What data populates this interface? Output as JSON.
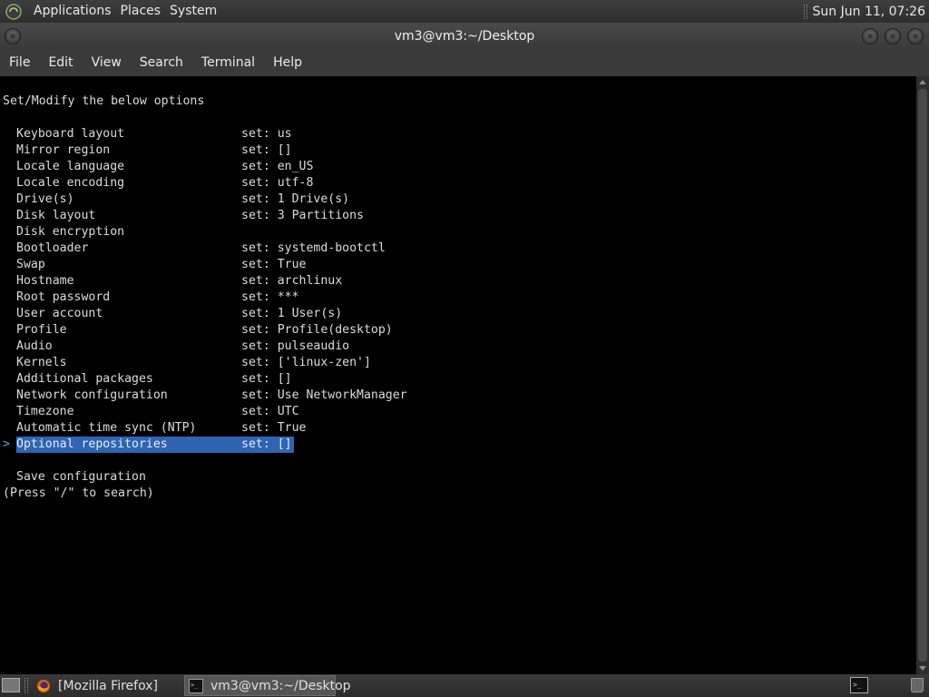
{
  "top_panel": {
    "menus": [
      "Applications",
      "Places",
      "System"
    ],
    "clock": "Sun Jun 11, 07:26"
  },
  "window": {
    "title": "vm3@vm3:~/Desktop"
  },
  "menubar": {
    "items": [
      "File",
      "Edit",
      "View",
      "Search",
      "Terminal",
      "Help"
    ]
  },
  "terminal": {
    "header": "Set/Modify the below options",
    "cursor": ">",
    "options": [
      {
        "label": "Keyboard layout",
        "value": "set: us"
      },
      {
        "label": "Mirror region",
        "value": "set: []"
      },
      {
        "label": "Locale language",
        "value": "set: en_US"
      },
      {
        "label": "Locale encoding",
        "value": "set: utf-8"
      },
      {
        "label": "Drive(s)",
        "value": "set: 1 Drive(s)"
      },
      {
        "label": "Disk layout",
        "value": "set: 3 Partitions"
      },
      {
        "label": "Disk encryption",
        "value": ""
      },
      {
        "label": "Bootloader",
        "value": "set: systemd-bootctl"
      },
      {
        "label": "Swap",
        "value": "set: True"
      },
      {
        "label": "Hostname",
        "value": "set: archlinux"
      },
      {
        "label": "Root password",
        "value": "set: ***"
      },
      {
        "label": "User account",
        "value": "set: 1 User(s)"
      },
      {
        "label": "Profile",
        "value": "set: Profile(desktop)"
      },
      {
        "label": "Audio",
        "value": "set: pulseaudio"
      },
      {
        "label": "Kernels",
        "value": "set: ['linux-zen']"
      },
      {
        "label": "Additional packages",
        "value": "set: []"
      },
      {
        "label": "Network configuration",
        "value": "set: Use NetworkManager"
      },
      {
        "label": "Timezone",
        "value": "set: UTC"
      },
      {
        "label": "Automatic time sync (NTP)",
        "value": "set: True"
      },
      {
        "label": "Optional repositories",
        "value": "set: []",
        "selected": true
      }
    ],
    "save_label": "Save configuration",
    "search_hint": "(Press \"/\" to search)"
  },
  "taskbar": {
    "tasks": [
      {
        "label": "[Mozilla Firefox]",
        "icon": "firefox-icon",
        "active": false
      },
      {
        "label": "vm3@vm3:~/Desktop",
        "icon": "terminal-icon",
        "active": true
      }
    ]
  },
  "colors": {
    "selection": "#2f64b2",
    "cursor": "#4aa3df",
    "terminal_bg": "#000000",
    "terminal_fg": "#dcdcdc"
  }
}
